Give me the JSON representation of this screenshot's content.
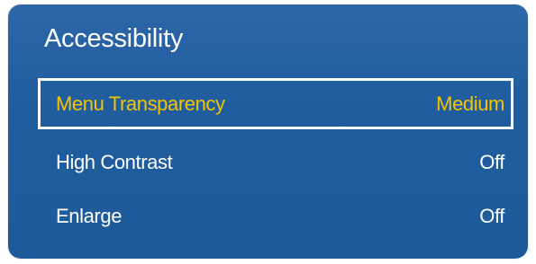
{
  "menu": {
    "title": "Accessibility",
    "items": [
      {
        "label": "Menu Transparency",
        "value": "Medium",
        "selected": true
      },
      {
        "label": "High Contrast",
        "value": "Off",
        "selected": false
      },
      {
        "label": "Enlarge",
        "value": "Off",
        "selected": false
      }
    ]
  },
  "colors": {
    "panel_background": "#1f5d9f",
    "text": "#ffffff",
    "selected_text": "#f5c400",
    "selection_border": "#ffffff"
  }
}
